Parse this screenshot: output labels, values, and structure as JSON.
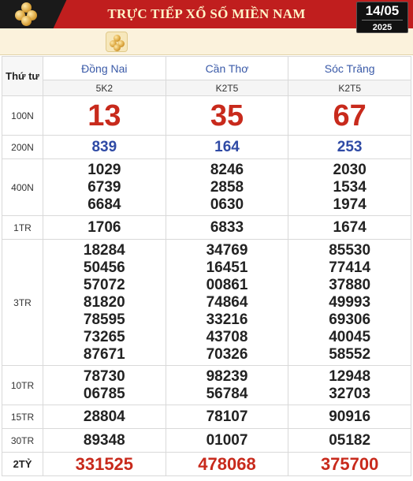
{
  "header": {
    "title": "TRỰC TIẾP XỔ SỐ MIỀN NAM",
    "date_day": "14/05",
    "date_year": "2025",
    "logo_icon": "lottery-balls-icon"
  },
  "table": {
    "day_label": "Thứ tư",
    "provinces": [
      {
        "name": "Đồng Nai",
        "code": "5K2"
      },
      {
        "name": "Cần Thơ",
        "code": "K2T5"
      },
      {
        "name": "Sóc Trăng",
        "code": "K2T5"
      }
    ],
    "prizes": [
      {
        "label": "100N",
        "values": [
          [
            "13"
          ],
          [
            "35"
          ],
          [
            "67"
          ]
        ]
      },
      {
        "label": "200N",
        "values": [
          [
            "839"
          ],
          [
            "164"
          ],
          [
            "253"
          ]
        ]
      },
      {
        "label": "400N",
        "values": [
          [
            "1029",
            "6739",
            "6684"
          ],
          [
            "8246",
            "2858",
            "0630"
          ],
          [
            "2030",
            "1534",
            "1974"
          ]
        ]
      },
      {
        "label": "1TR",
        "values": [
          [
            "1706"
          ],
          [
            "6833"
          ],
          [
            "1674"
          ]
        ]
      },
      {
        "label": "3TR",
        "values": [
          [
            "18284",
            "50456",
            "57072",
            "81820",
            "78595",
            "73265",
            "87671"
          ],
          [
            "34769",
            "16451",
            "00861",
            "74864",
            "33216",
            "43708",
            "70326"
          ],
          [
            "85530",
            "77414",
            "37880",
            "49993",
            "69306",
            "40045",
            "58552"
          ]
        ]
      },
      {
        "label": "10TR",
        "values": [
          [
            "78730",
            "06785"
          ],
          [
            "98239",
            "56784"
          ],
          [
            "12948",
            "32703"
          ]
        ]
      },
      {
        "label": "15TR",
        "values": [
          [
            "28804"
          ],
          [
            "78107"
          ],
          [
            "90916"
          ]
        ]
      },
      {
        "label": "30TR",
        "values": [
          [
            "89348"
          ],
          [
            "01007"
          ],
          [
            "05182"
          ]
        ]
      },
      {
        "label": "2TỶ",
        "values": [
          [
            "331525"
          ],
          [
            "478068"
          ],
          [
            "375700"
          ]
        ]
      }
    ]
  },
  "colors": {
    "banner_red": "#c01e1e",
    "prize_red": "#c82a1c",
    "prize_blue": "#2f4aa5",
    "province_blue": "#3a5aa8"
  }
}
